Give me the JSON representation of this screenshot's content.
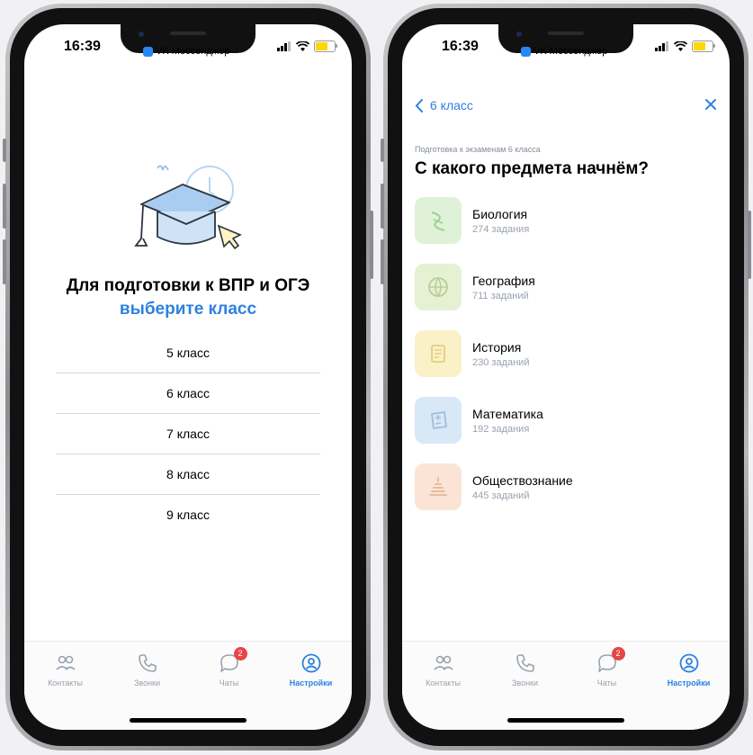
{
  "status": {
    "time": "16:39",
    "app_name": "VK Мессенджер"
  },
  "left": {
    "title": "Для подготовки к ВПР и ОГЭ",
    "subtitle": "выберите класс",
    "grades": [
      "5 класс",
      "6 класс",
      "7 класс",
      "8 класс",
      "9 класс"
    ]
  },
  "right": {
    "back_label": "6 класс",
    "close_icon": "close-icon",
    "caption": "Подготовка к экзаменам 6 класса",
    "headline": "С какого предмета начнём?",
    "subjects": [
      {
        "name": "Биология",
        "count": "274 задания",
        "color": "#dff2d8"
      },
      {
        "name": "География",
        "count": "711 заданий",
        "color": "#e6f0d2"
      },
      {
        "name": "История",
        "count": "230 заданий",
        "color": "#fbf1c8"
      },
      {
        "name": "Математика",
        "count": "192 задания",
        "color": "#d9e8f7"
      },
      {
        "name": "Обществознание",
        "count": "445 заданий",
        "color": "#fbe4d6"
      }
    ]
  },
  "tabbar": {
    "items": [
      {
        "label": "Контакты",
        "icon": "contacts-icon"
      },
      {
        "label": "Звонки",
        "icon": "phone-icon"
      },
      {
        "label": "Чаты",
        "icon": "chat-icon",
        "badge": "2"
      },
      {
        "label": "Настройки",
        "icon": "settings-icon"
      }
    ],
    "active_color": "#2d81e0",
    "badge_color": "#e64646"
  }
}
